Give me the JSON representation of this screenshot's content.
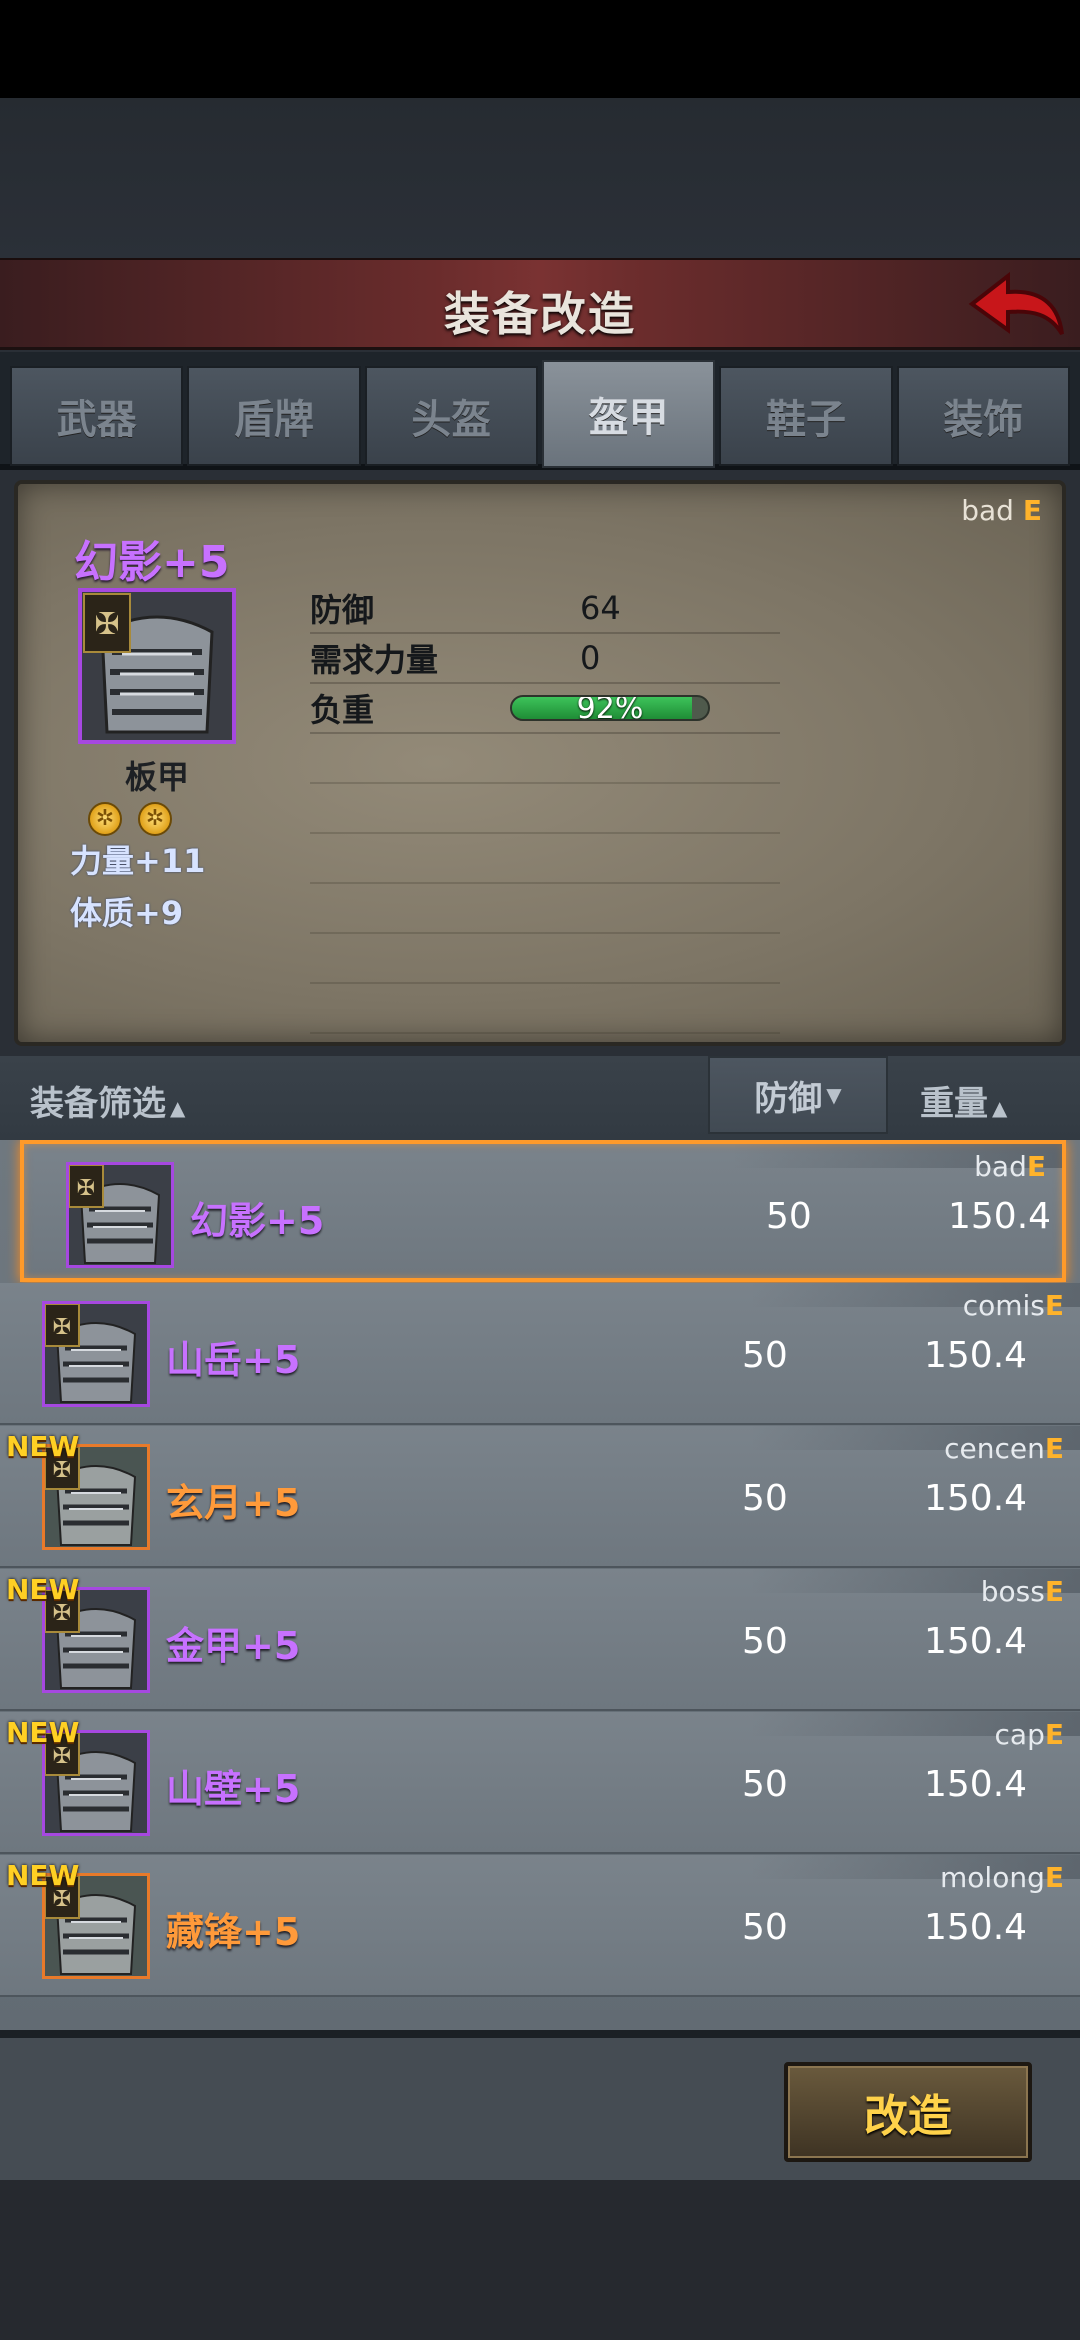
{
  "header": {
    "title": "装备改造"
  },
  "tabs": [
    {
      "label": "武器",
      "active": false
    },
    {
      "label": "盾牌",
      "active": false
    },
    {
      "label": "头盔",
      "active": false
    },
    {
      "label": "盔甲",
      "active": true
    },
    {
      "label": "鞋子",
      "active": false
    },
    {
      "label": "装饰",
      "active": false
    }
  ],
  "detail": {
    "grade_owner": "bad",
    "grade": "E",
    "name": "幻影+5",
    "type": "板甲",
    "stats": [
      {
        "label": "防御",
        "value": "64"
      },
      {
        "label": "需求力量",
        "value": "0"
      },
      {
        "label": "负重",
        "value": "92%",
        "fill_percent": 92
      }
    ],
    "bonuses": [
      "力量+11",
      "体质+9"
    ],
    "gem_count": 2
  },
  "filter": {
    "label": "装备筛选",
    "sort_defense": "防御",
    "sort_weight": "重量"
  },
  "list": [
    {
      "owner": "bad",
      "grade": "E",
      "name": "幻影+5",
      "defense": "50",
      "weight": "150.4",
      "new": false,
      "selected": true,
      "rarity": "purple"
    },
    {
      "owner": "comis",
      "grade": "E",
      "name": "山岳+5",
      "defense": "50",
      "weight": "150.4",
      "new": false,
      "selected": false,
      "rarity": "purple"
    },
    {
      "owner": "cencen",
      "grade": "E",
      "name": "玄月+5",
      "defense": "50",
      "weight": "150.4",
      "new": true,
      "selected": false,
      "rarity": "orange"
    },
    {
      "owner": "boss",
      "grade": "E",
      "name": "金甲+5",
      "defense": "50",
      "weight": "150.4",
      "new": true,
      "selected": false,
      "rarity": "purple"
    },
    {
      "owner": "cap",
      "grade": "E",
      "name": "山壁+5",
      "defense": "50",
      "weight": "150.4",
      "new": true,
      "selected": false,
      "rarity": "purple"
    },
    {
      "owner": "molong",
      "grade": "E",
      "name": "藏锋+5",
      "defense": "50",
      "weight": "150.4",
      "new": true,
      "selected": false,
      "rarity": "orange"
    }
  ],
  "new_badge": "NEW",
  "actions": {
    "reforge_label": "改造"
  },
  "colors": {
    "purple": "#c771ff",
    "orange": "#ff9a3a",
    "grade": "#ffb32b",
    "selected_border": "#ff9a2a"
  }
}
